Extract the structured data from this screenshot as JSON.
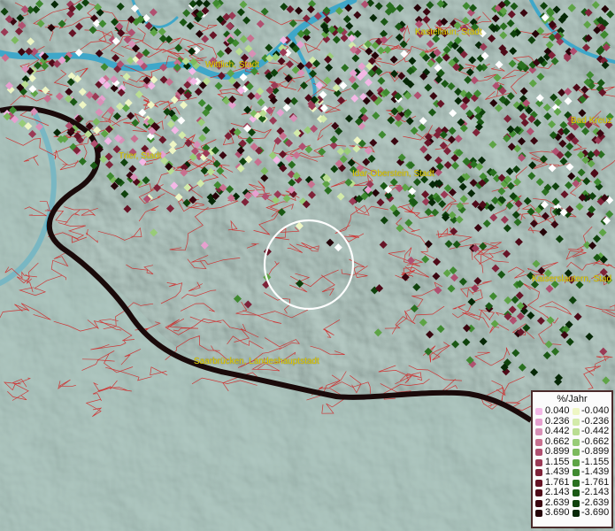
{
  "cities": [
    {
      "name": "Kastellaun, Stadt"
    },
    {
      "name": "Wittlich, Stadt"
    },
    {
      "name": "Bad Kreuz"
    },
    {
      "name": "Trier, Stadt"
    },
    {
      "name": "Idar-Oberstein, Stadt"
    },
    {
      "name": "Kaiserslautern, Stad"
    },
    {
      "name": "Saarbrücken, Landeshauptstadt"
    }
  ],
  "legend": {
    "title": "%/Jahr",
    "positive": [
      "0.040",
      "0.236",
      "0.442",
      "0.662",
      "0.899",
      "1.155",
      "1.439",
      "1.761",
      "2.143",
      "2.639",
      "3.690"
    ],
    "negative": [
      "-0.040",
      "-0.236",
      "-0.442",
      "-0.662",
      "-0.899",
      "-1.155",
      "-1.439",
      "-1.761",
      "-2.143",
      "-2.639",
      "-3.690"
    ],
    "positive_colors": [
      "#f3b8e6",
      "#e6a0cf",
      "#d890b6",
      "#c8708f",
      "#b05070",
      "#9a3a55",
      "#7e2238",
      "#661426",
      "#4e0a18",
      "#3a0610",
      "#250308"
    ],
    "negative_colors": [
      "#eef6c4",
      "#d3ebaa",
      "#b9dd92",
      "#98cc78",
      "#7cba5e",
      "#5ea446",
      "#3f8a30",
      "#2a7020",
      "#1a5814",
      "#0f420c",
      "#062806"
    ]
  },
  "colors": {
    "terrain": "#9bb5ae",
    "water": "#3fa7c9",
    "boundary": "#d42020",
    "border_line": "#1a0a0a",
    "label": "#e8d200"
  }
}
